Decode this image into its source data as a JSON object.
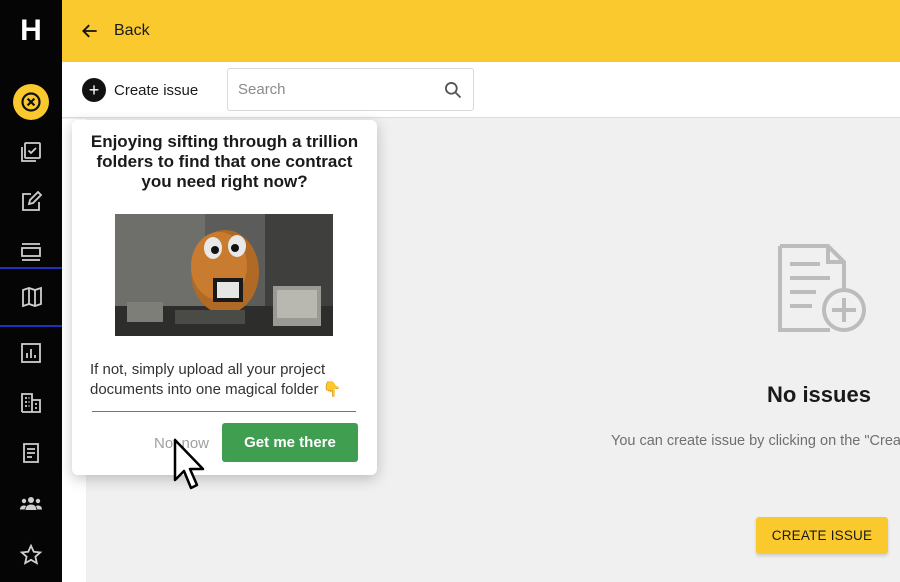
{
  "app": {
    "logo_letter": "H"
  },
  "sidebar": {
    "items": [
      {
        "icon": "close-circle-icon",
        "state": "active"
      },
      {
        "icon": "checklist-icon"
      },
      {
        "icon": "edit-icon"
      },
      {
        "icon": "list-icon"
      },
      {
        "icon": "map-icon",
        "state": "selected"
      },
      {
        "icon": "bar-chart-icon"
      },
      {
        "icon": "building-icon"
      },
      {
        "icon": "document-icon"
      },
      {
        "icon": "team-icon"
      },
      {
        "icon": "star-icon"
      }
    ]
  },
  "topbar": {
    "back_label": "Back"
  },
  "toolbar": {
    "create_issue_label": "Create issue",
    "search_placeholder": "Search"
  },
  "popover": {
    "title": "Enjoying sifting through a trillion folders to find that one contract you need right now?",
    "body": "If not, simply upload all your project documents into one magical folder 👇",
    "not_now_label": "Not now",
    "cta_label": "Get me there"
  },
  "empty_state": {
    "title": "No issues",
    "description": "You can create issue by clicking on the \"Create issue\" button",
    "button_label": "CREATE ISSUE"
  },
  "colors": {
    "accent": "#fac92e",
    "sidebar_bg": "#050505",
    "success": "#3f9e4f",
    "selected_outline": "#1f2fbf"
  }
}
